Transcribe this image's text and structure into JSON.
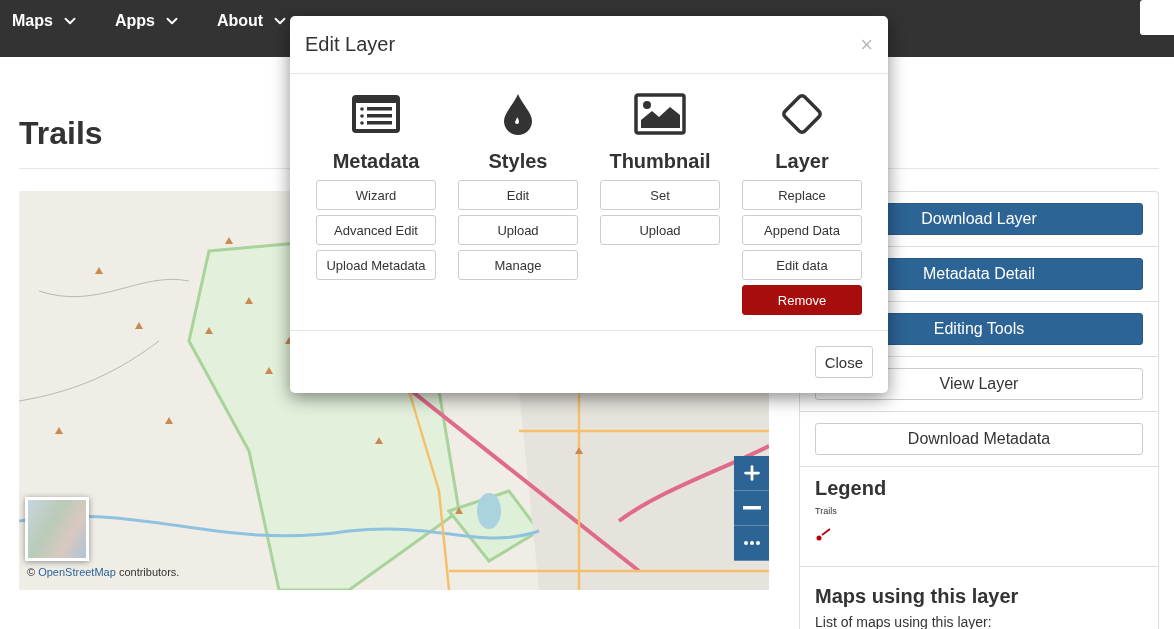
{
  "navbar": {
    "menus": [
      {
        "label": "Maps"
      },
      {
        "label": "Apps"
      },
      {
        "label": "About"
      }
    ]
  },
  "page": {
    "title": "Trails"
  },
  "map": {
    "attribution": {
      "prefix": "©",
      "link": "OpenStreetMap",
      "suffix": "contributors."
    }
  },
  "sidebar": {
    "actions": [
      {
        "label": "Download Layer",
        "kind": "primary"
      },
      {
        "label": "Metadata Detail",
        "kind": "primary"
      },
      {
        "label": "Editing Tools",
        "kind": "primary"
      },
      {
        "label": "View Layer",
        "kind": "default"
      },
      {
        "label": "Download Metadata",
        "kind": "default"
      }
    ],
    "legend": {
      "title": "Legend",
      "layer": "Trails"
    },
    "maps_section": {
      "title": "Maps using this layer",
      "text": "List of maps using this layer:"
    }
  },
  "modal": {
    "title": "Edit Layer",
    "close": "×",
    "sections": [
      {
        "kind": "metadata",
        "title": "Metadata",
        "buttons": [
          {
            "label": "Wizard",
            "kind": "default"
          },
          {
            "label": "Advanced Edit",
            "kind": "default"
          },
          {
            "label": "Upload Metadata",
            "kind": "default"
          }
        ]
      },
      {
        "kind": "styles",
        "title": "Styles",
        "buttons": [
          {
            "label": "Edit",
            "kind": "default"
          },
          {
            "label": "Upload",
            "kind": "default"
          },
          {
            "label": "Manage",
            "kind": "default"
          }
        ]
      },
      {
        "kind": "thumbnail",
        "title": "Thumbnail",
        "buttons": [
          {
            "label": "Set",
            "kind": "default"
          },
          {
            "label": "Upload",
            "kind": "default"
          }
        ]
      },
      {
        "kind": "layer",
        "title": "Layer",
        "buttons": [
          {
            "label": "Replace",
            "kind": "default"
          },
          {
            "label": "Append Data",
            "kind": "default"
          },
          {
            "label": "Edit data",
            "kind": "default"
          },
          {
            "label": "Remove",
            "kind": "danger"
          }
        ]
      }
    ],
    "footer_button": "Close"
  }
}
